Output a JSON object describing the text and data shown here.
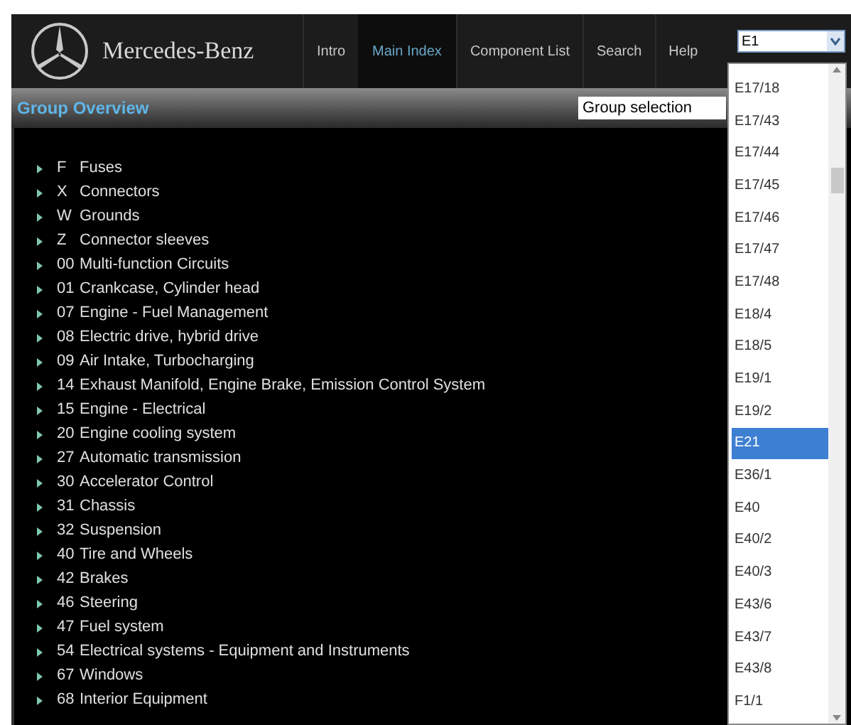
{
  "brand": "Mercedes-Benz",
  "nav": [
    {
      "label": "Intro",
      "selected": false
    },
    {
      "label": "Main Index",
      "selected": true
    },
    {
      "label": "Component List",
      "selected": false
    },
    {
      "label": "Search",
      "selected": false
    },
    {
      "label": "Help",
      "selected": false
    }
  ],
  "component_select": {
    "value": "E1",
    "expanded": true,
    "options": [
      {
        "label": "E17/18",
        "selected": false
      },
      {
        "label": "E17/43",
        "selected": false
      },
      {
        "label": "E17/44",
        "selected": false
      },
      {
        "label": "E17/45",
        "selected": false
      },
      {
        "label": "E17/46",
        "selected": false
      },
      {
        "label": "E17/47",
        "selected": false
      },
      {
        "label": "E17/48",
        "selected": false
      },
      {
        "label": "E18/4",
        "selected": false
      },
      {
        "label": "E18/5",
        "selected": false
      },
      {
        "label": "E19/1",
        "selected": false
      },
      {
        "label": "E19/2",
        "selected": false
      },
      {
        "label": "E21",
        "selected": true
      },
      {
        "label": "E36/1",
        "selected": false
      },
      {
        "label": "E40",
        "selected": false
      },
      {
        "label": "E40/2",
        "selected": false
      },
      {
        "label": "E40/3",
        "selected": false
      },
      {
        "label": "E43/6",
        "selected": false
      },
      {
        "label": "E43/7",
        "selected": false
      },
      {
        "label": "E43/8",
        "selected": false
      },
      {
        "label": "F1/1",
        "selected": false
      }
    ]
  },
  "section_title": "Group Overview",
  "group_selection": {
    "value": "Group selection"
  },
  "groups": [
    {
      "code": "F",
      "label": "Fuses"
    },
    {
      "code": "X",
      "label": "Connectors"
    },
    {
      "code": "W",
      "label": "Grounds"
    },
    {
      "code": "Z",
      "label": "Connector sleeves"
    },
    {
      "code": "00",
      "label": "Multi-function Circuits"
    },
    {
      "code": "01",
      "label": "Crankcase, Cylinder head"
    },
    {
      "code": "07",
      "label": "Engine - Fuel Management"
    },
    {
      "code": "08",
      "label": "Electric drive, hybrid drive"
    },
    {
      "code": "09",
      "label": "Air Intake, Turbocharging"
    },
    {
      "code": "14",
      "label": "Exhaust Manifold, Engine Brake, Emission Control System"
    },
    {
      "code": "15",
      "label": "Engine - Electrical"
    },
    {
      "code": "20",
      "label": "Engine cooling system"
    },
    {
      "code": "27",
      "label": "Automatic transmission"
    },
    {
      "code": "30",
      "label": "Accelerator Control"
    },
    {
      "code": "31",
      "label": "Chassis"
    },
    {
      "code": "32",
      "label": "Suspension"
    },
    {
      "code": "40",
      "label": "Tire and Wheels"
    },
    {
      "code": "42",
      "label": "Brakes"
    },
    {
      "code": "46",
      "label": "Steering"
    },
    {
      "code": "47",
      "label": "Fuel system"
    },
    {
      "code": "54",
      "label": "Electrical systems - Equipment and Instruments"
    },
    {
      "code": "67",
      "label": "Windows"
    },
    {
      "code": "68",
      "label": "Interior Equipment"
    }
  ]
}
